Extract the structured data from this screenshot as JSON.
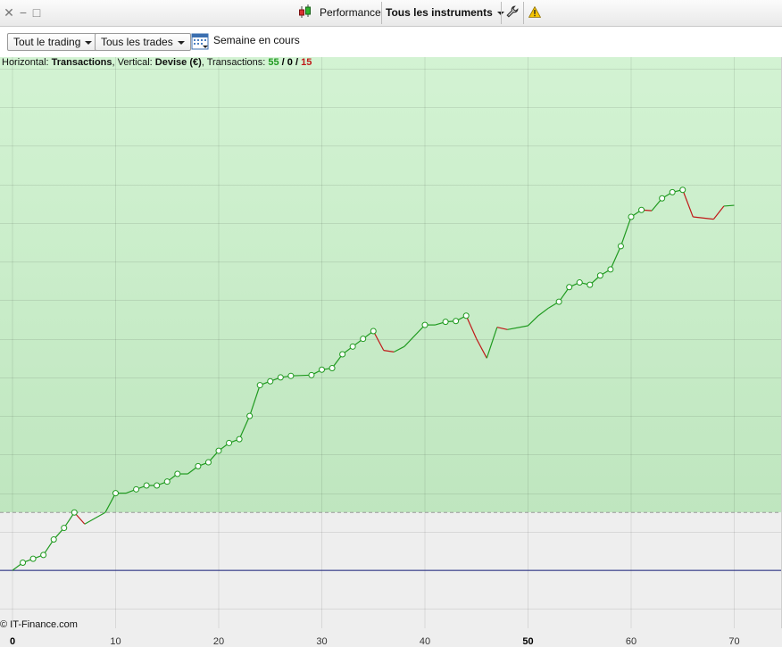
{
  "toolbar": {
    "performance_label": "Performance",
    "instruments_label": "Tous les instruments",
    "filter_trading": "Tout le trading",
    "filter_trades": "Tous les trades",
    "period_label": "Semaine en cours"
  },
  "info": {
    "prefix": "Horizontal: ",
    "h_value": "Transactions",
    "vertical_prefix": ", Vertical: ",
    "v_value": "Devise (€)",
    "transactions_prefix": ", Transactions: ",
    "wins": "55",
    "slash1": " / ",
    "neutral": "0",
    "slash2": " / ",
    "losses": "15"
  },
  "copyright": "© IT-Finance.com",
  "colors": {
    "win": "#1f9a1f",
    "loss": "#c01818",
    "baseline": "#1a237e",
    "profit_zone": "#c8edc8",
    "neutral_zone": "#eeeeee"
  },
  "chart_data": {
    "type": "line",
    "xlabel": "",
    "ylabel": "",
    "xlim": [
      0,
      70
    ],
    "ylim": [
      -7.5,
      66.5
    ],
    "x_ticks": [
      "0",
      "10",
      "20",
      "30",
      "40",
      "50",
      "60",
      "70"
    ],
    "series": [
      {
        "x": [
          0,
          1,
          2,
          3,
          4,
          5,
          6,
          7,
          9,
          10,
          11,
          12,
          13,
          14,
          15,
          16,
          17,
          18,
          19,
          20,
          21,
          22,
          23,
          24,
          25,
          26,
          27,
          29,
          30,
          31,
          32,
          33,
          34,
          35,
          36,
          37,
          38,
          40,
          41,
          42,
          43,
          44,
          45,
          46,
          47,
          48,
          50,
          51,
          52,
          53,
          54,
          55,
          56,
          57,
          58,
          59,
          60,
          61,
          62,
          63,
          64,
          65,
          66,
          68,
          69,
          70
        ],
        "y": [
          0,
          1,
          1.5,
          2,
          4,
          5.5,
          7.5,
          6,
          7.5,
          10,
          10,
          10.5,
          11,
          11,
          11.5,
          12.5,
          12.5,
          13.5,
          14,
          15.5,
          16.5,
          17,
          20,
          24,
          24.5,
          25,
          25.2,
          25.3,
          26,
          26.2,
          28,
          29,
          30,
          31,
          28.5,
          28.3,
          29,
          31.8,
          31.8,
          32.2,
          32.3,
          33,
          30,
          27.5,
          31.5,
          31.2,
          31.7,
          33,
          34,
          34.8,
          36.7,
          37.3,
          37,
          38.2,
          39,
          42,
          45.8,
          46.7,
          46.6,
          48.2,
          49,
          49.3,
          45.8,
          45.5,
          47.2,
          47.3
        ]
      }
    ],
    "markers_x": [
      1,
      2,
      3,
      4,
      5,
      6,
      10,
      12,
      13,
      14,
      15,
      16,
      18,
      19,
      20,
      21,
      22,
      23,
      24,
      25,
      26,
      27,
      29,
      30,
      31,
      32,
      33,
      34,
      35,
      40,
      42,
      43,
      44,
      53,
      54,
      55,
      56,
      57,
      58,
      59,
      60,
      61,
      63,
      64,
      65
    ],
    "loss_segments_start_x": [
      6,
      35,
      36,
      44,
      45,
      47,
      61,
      65,
      66,
      68
    ]
  }
}
